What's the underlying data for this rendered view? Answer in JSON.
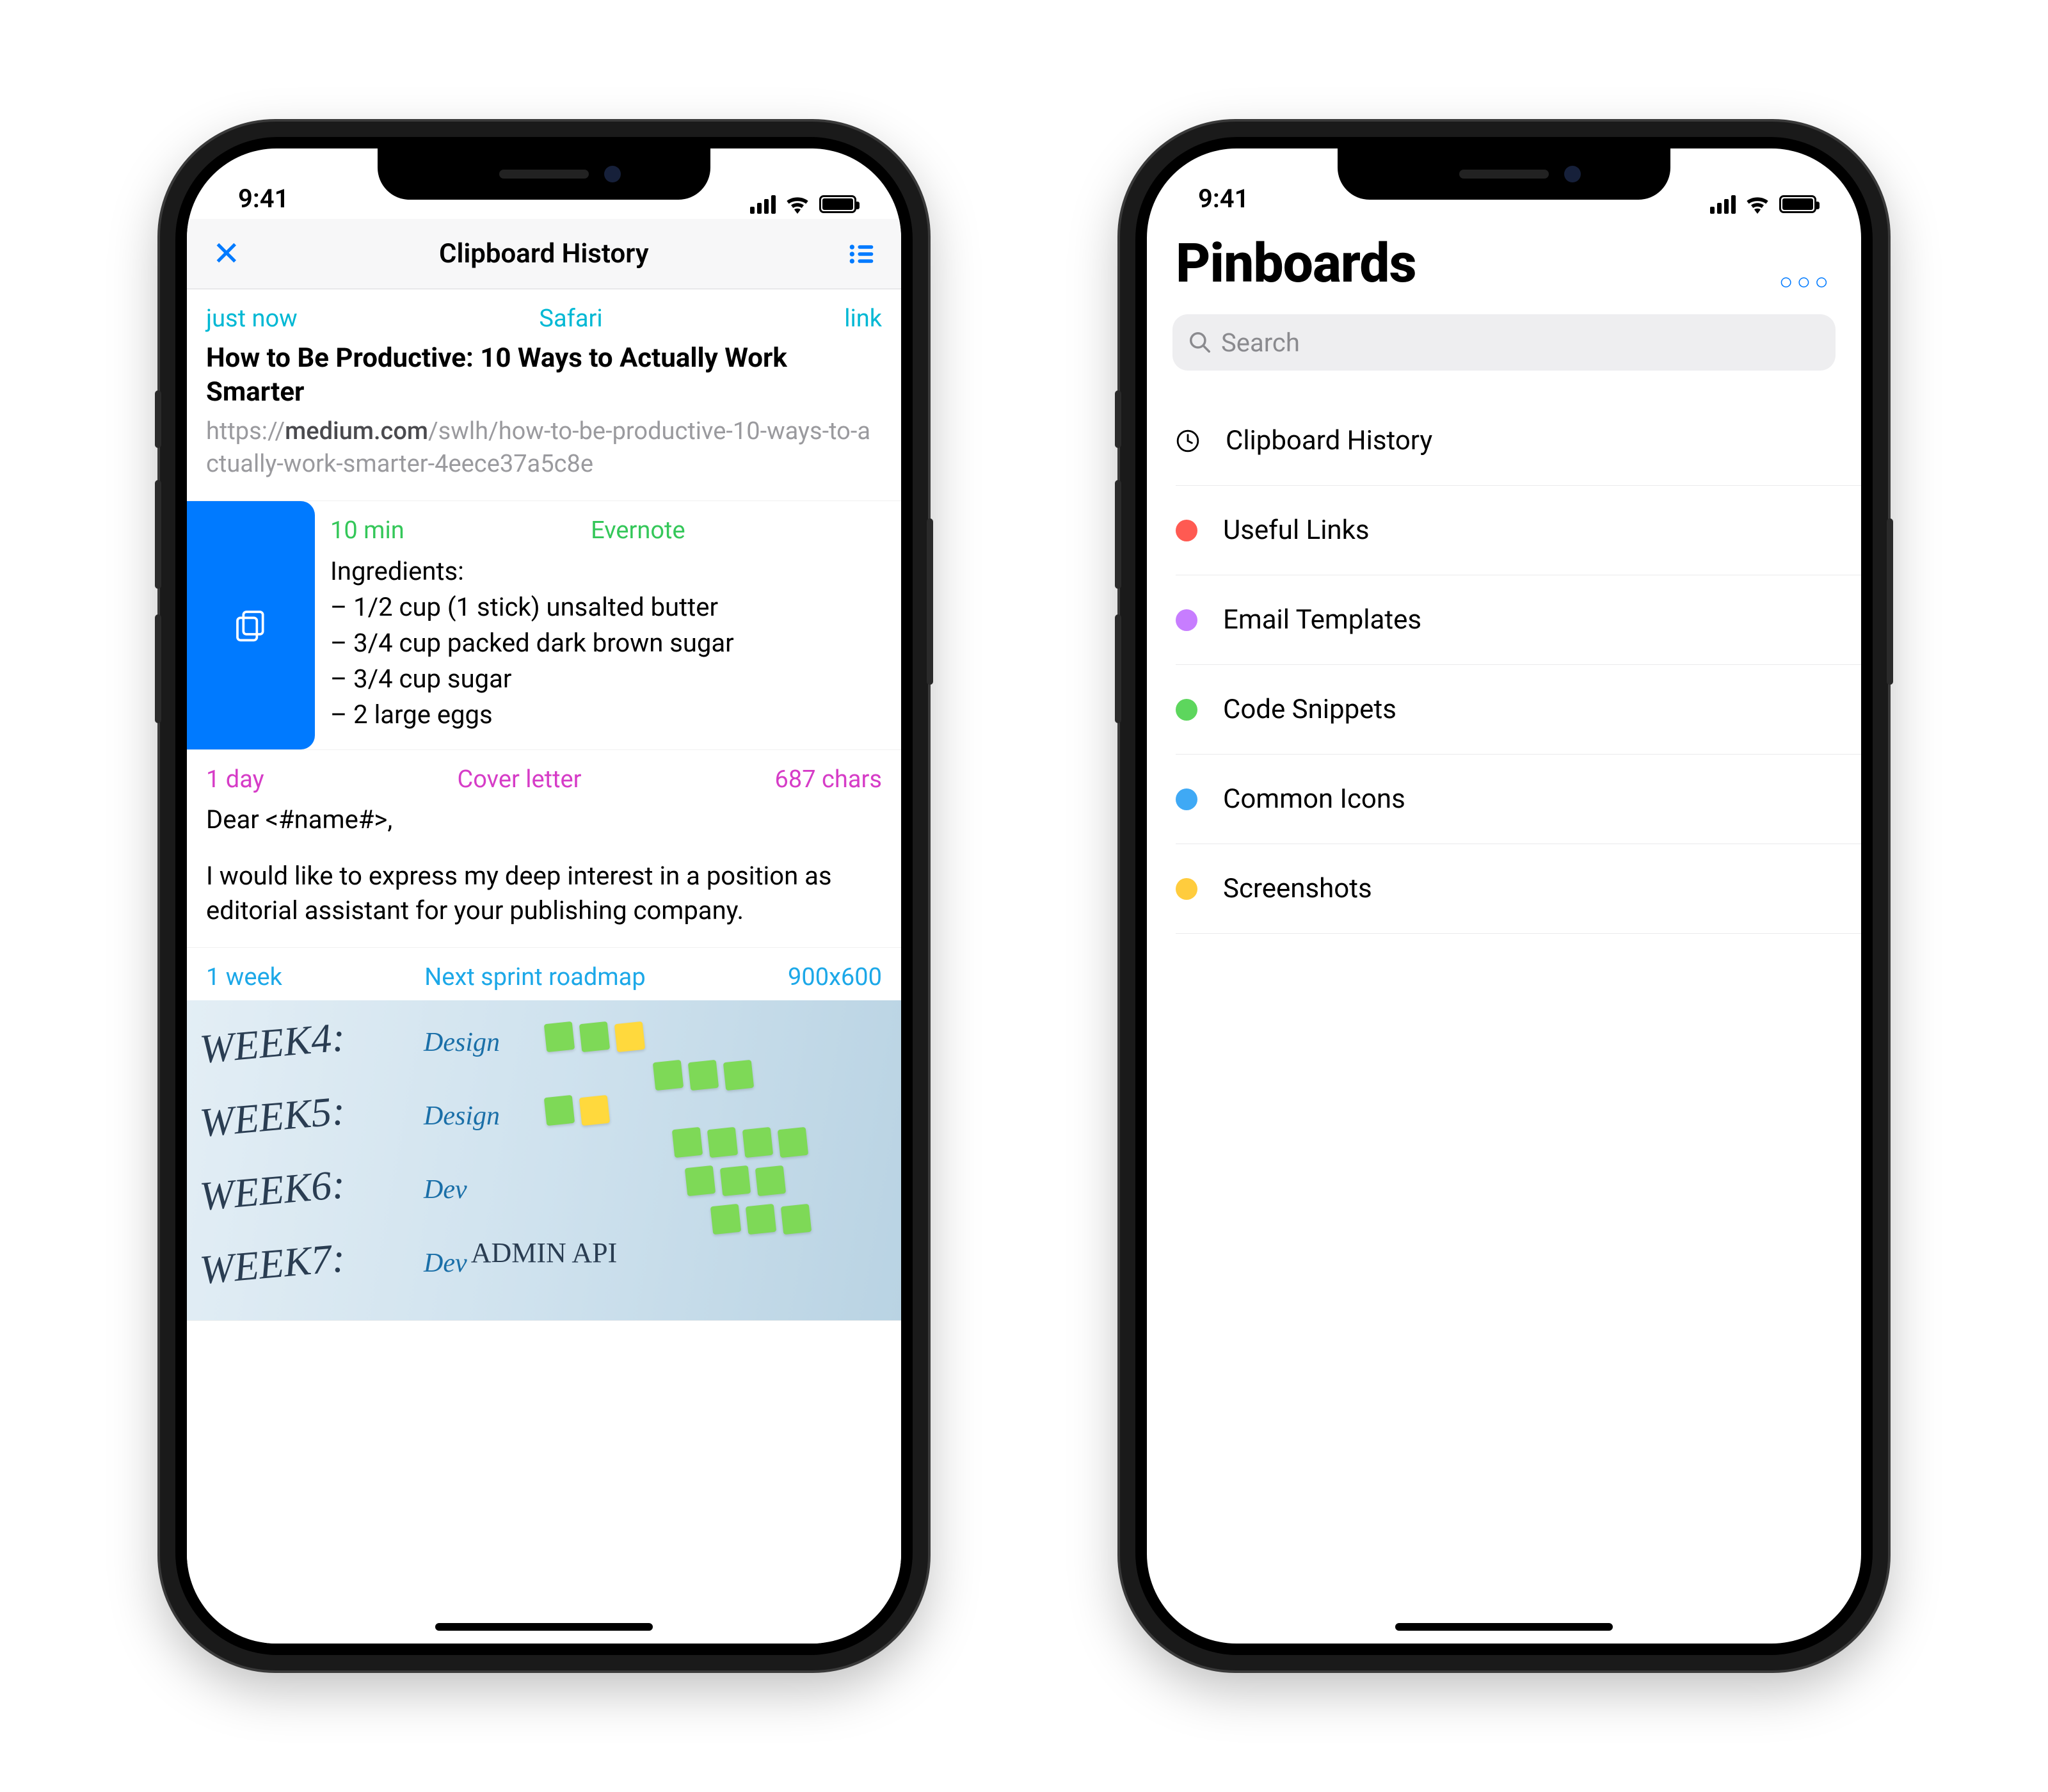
{
  "status": {
    "time": "9:41"
  },
  "left": {
    "nav_title": "Clipboard History",
    "cards": [
      {
        "time": "just now",
        "source": "Safari",
        "right": "link",
        "title": "How to Be Productive: 10 Ways to Actually Work Smarter",
        "url_pre": "https://",
        "url_bold": "medium.com",
        "url_post": "/swlh/how-to-be-productive-10-ways-to-actually-work-smarter-4eece37a5c8e"
      },
      {
        "time": "10 min",
        "source": "Evernote",
        "body_label": "Ingredients:",
        "lines": [
          " – 1/2 cup (1 stick) unsalted butter",
          " – 3/4 cup packed dark brown sugar",
          " – 3/4 cup sugar",
          " – 2 large eggs"
        ]
      },
      {
        "time": "1 day",
        "source": "Cover letter",
        "right": "687 chars",
        "line1": "Dear <#name#>,",
        "line2": "I would like to express my deep interest in a position as editorial assistant for your publishing company."
      },
      {
        "time": "1 week",
        "source": "Next sprint roadmap",
        "right": "900x600",
        "weeks": [
          "WEEK4:",
          "WEEK5:",
          "WEEK6:",
          "WEEK7:"
        ],
        "design": "Design",
        "dev": "Dev",
        "admin": "ADMIN API"
      }
    ]
  },
  "right": {
    "title": "Pinboards",
    "search_placeholder": "Search",
    "items": [
      {
        "label": "Clipboard History",
        "icon": "clock"
      },
      {
        "label": "Useful Links",
        "color": "red"
      },
      {
        "label": "Email Templates",
        "color": "purple"
      },
      {
        "label": "Code Snippets",
        "color": "green"
      },
      {
        "label": "Common Icons",
        "color": "blue"
      },
      {
        "label": "Screenshots",
        "color": "yellow"
      }
    ]
  }
}
